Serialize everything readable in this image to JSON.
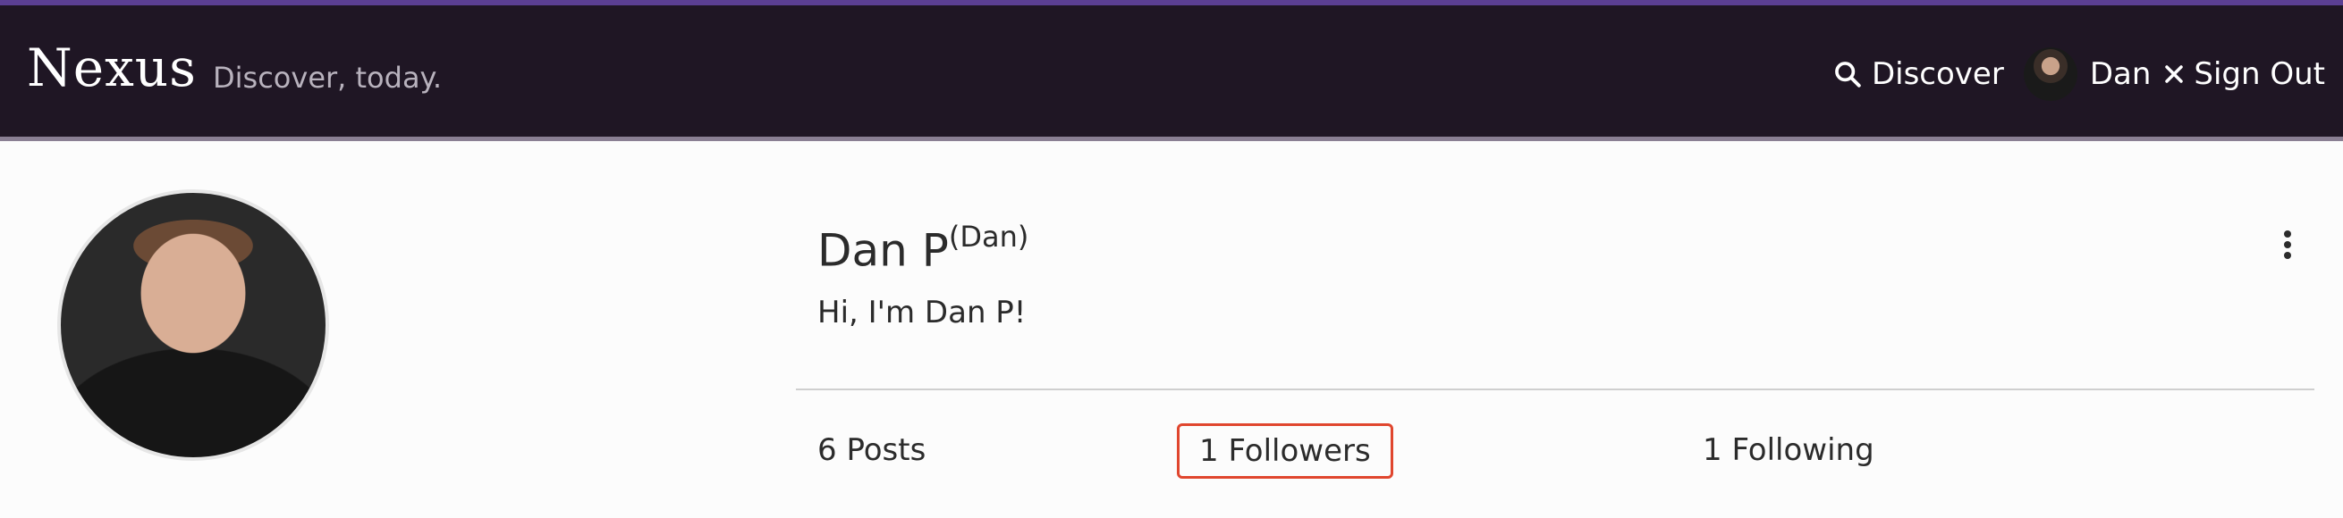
{
  "navbar": {
    "brand": "Nexus",
    "tagline": "Discover, today.",
    "discover_label": "Discover",
    "discover_icon": "search-icon",
    "user_name": "Dan",
    "signout_label": "Sign Out",
    "signout_icon": "close-icon",
    "accent_color": "#5b3f93",
    "background_color": "#1f1624"
  },
  "profile": {
    "name": "Dan P",
    "username": "(Dan)",
    "bio": "Hi, I'm Dan P!",
    "menu_icon": "more-vertical-icon",
    "stats": {
      "posts": "6 Posts",
      "followers": "1 Followers",
      "following": "1 Following"
    },
    "highlight_color": "#e0462e"
  }
}
